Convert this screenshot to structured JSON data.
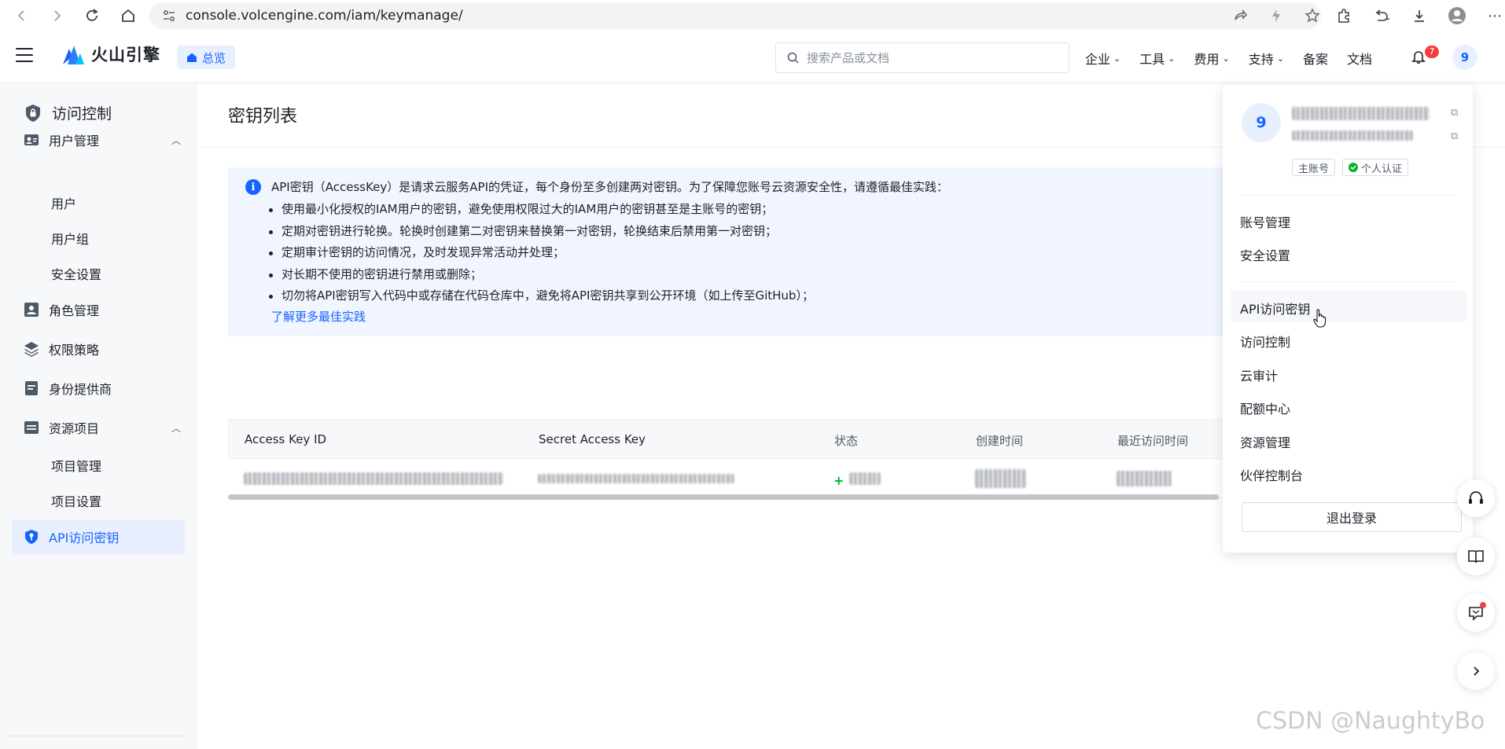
{
  "browser": {
    "url": "console.volcengine.com/iam/keymanage/"
  },
  "header": {
    "brand": "火山引擎",
    "overview": "总览",
    "search_placeholder": "搜索产品或文档",
    "menu": [
      "企业",
      "工具",
      "费用",
      "支持"
    ],
    "links": [
      "备案",
      "文档"
    ],
    "notification_count": "7",
    "avatar": "9"
  },
  "sidebar": {
    "title": "访问控制",
    "groups": [
      {
        "label": "用户管理",
        "children": [
          "用户",
          "用户组",
          "安全设置"
        ]
      },
      {
        "label": "角色管理"
      },
      {
        "label": "权限策略"
      },
      {
        "label": "身份提供商"
      },
      {
        "label": "资源项目",
        "children": [
          "项目管理",
          "项目设置"
        ]
      }
    ],
    "active": "API访问密钥"
  },
  "main": {
    "title": "密钥列表",
    "info": {
      "head": "API密钥（AccessKey）是请求云服务API的凭证，每个身份至多创建两对密钥。为了保障您账号云资源安全性，请遵循最佳实践：",
      "items": [
        "使用最小化授权的IAM用户的密钥，避免使用权限过大的IAM用户的密钥甚至是主账号的密钥；",
        "定期对密钥进行轮换。轮换时创建第二对密钥来替换第一对密钥，轮换结束后禁用第一对密钥；",
        "定期审计密钥的访问情况，及时发现异常活动并处理；",
        "对长期不使用的密钥进行禁用或删除；",
        "切勿将API密钥写入代码中或存储在代码仓库中，避免将API密钥共享到公开环境（如上传至GitHub）；"
      ],
      "link": "了解更多最佳实践"
    },
    "table": {
      "columns": [
        "Access Key ID",
        "Secret Access Key",
        "状态",
        "创建时间",
        "最近访问时间"
      ]
    }
  },
  "dropdown": {
    "avatar": "9",
    "tags": [
      "主账号",
      "个人认证"
    ],
    "group1": [
      "账号管理",
      "安全设置"
    ],
    "group2": [
      "API访问密钥",
      "访问控制",
      "云审计",
      "配额中心",
      "资源管理",
      "伙伴控制台"
    ],
    "logout": "退出登录"
  },
  "watermark": "CSDN @NaughtyBo",
  "colors": {
    "primary": "#1664ff",
    "danger": "#f53f3f",
    "success": "#00b42a",
    "sidebar_bg": "#f7f8fa",
    "info_bg": "#f0f5ff"
  }
}
